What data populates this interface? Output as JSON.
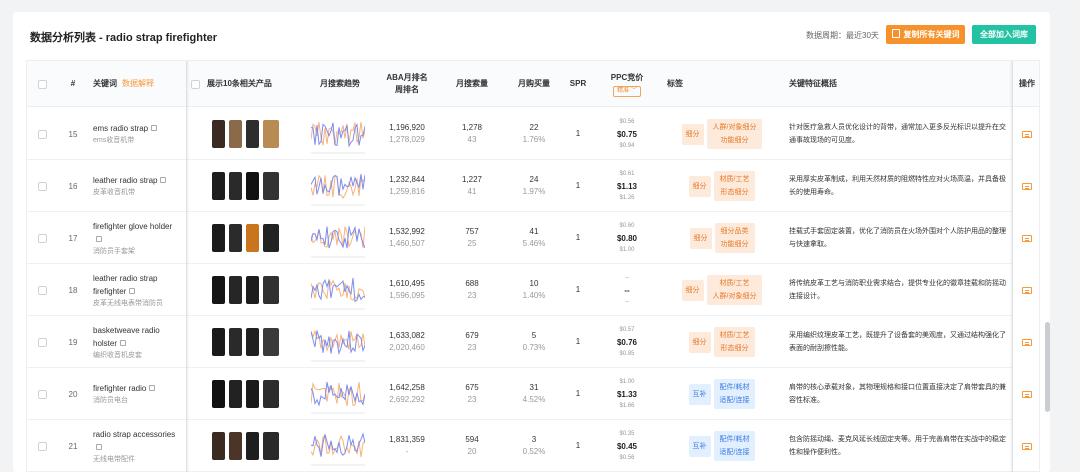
{
  "title": "数据分析列表 - radio strap firefighter",
  "period": "数据周期：最近30天",
  "buttons": {
    "copy_all": "复制所有关键词",
    "add_all": "全部加入词库"
  },
  "headers": {
    "index": "#",
    "keyword": "关键词",
    "keyword_explain": "数据解释",
    "products": "展示10条相关产品",
    "trend": "月搜索趋势",
    "aba": "ABA月排名\n周排名",
    "search_volume": "月搜索量",
    "purchases": "月购买量",
    "spr": "SPR",
    "ppc": "PPC竞价",
    "ppc_mode": "精准",
    "tags": "标签",
    "features": "关键特征概括",
    "ops": "操作"
  },
  "rows": [
    {
      "index": "15",
      "keyword": "ems radio strap",
      "keyword_cn": "ems收音机带",
      "aba": "1,196,920",
      "aba_week": "1,278,029",
      "volume": "1,278",
      "volume_sub": "43",
      "purchases": "22",
      "purchase_rate": "1.76%",
      "spr": "1",
      "ppc_high": "$0.56",
      "ppc_mid": "$0.75",
      "ppc_low": "$0.94",
      "tag_type": "细分",
      "tag_color": "fen",
      "tag_a": "人群/对象细分",
      "tag_b": "功能细分",
      "feature": "针对医疗急救人员优化设计的背带，通常加入更多反光标识以提升在交通事故现场的可见度。",
      "product_colors": [
        "#3a2a22",
        "#8b6a4a",
        "#2d2d2d",
        "#b98b54"
      ]
    },
    {
      "index": "16",
      "keyword": "leather radio strap",
      "keyword_cn": "皮革收音机带",
      "aba": "1,232,844",
      "aba_week": "1,259,816",
      "volume": "1,227",
      "volume_sub": "41",
      "purchases": "24",
      "purchase_rate": "1.97%",
      "spr": "1",
      "ppc_high": "$0.61",
      "ppc_mid": "$1.13",
      "ppc_low": "$1.26",
      "tag_type": "细分",
      "tag_color": "fen",
      "tag_a": "材质/工艺",
      "tag_b": "形态细分",
      "feature": "采用厚实皮革制成，利用天然材质的阻燃特性应对火场高温，并具备极长的使用寿命。",
      "product_colors": [
        "#1e1e1e",
        "#2a2a2a",
        "#111111",
        "#333333"
      ]
    },
    {
      "index": "17",
      "keyword": "firefighter glove holder",
      "keyword_cn": "消防员手套架",
      "aba": "1,532,992",
      "aba_week": "1,460,507",
      "volume": "757",
      "volume_sub": "25",
      "purchases": "41",
      "purchase_rate": "5.46%",
      "spr": "1",
      "ppc_high": "$0.60",
      "ppc_mid": "$0.80",
      "ppc_low": "$1.00",
      "tag_type": "细分",
      "tag_color": "fen",
      "tag_a": "细分品类",
      "tag_b": "功能细分",
      "feature": "挂载式手套固定装置，优化了消防员在火场外围对个人防护用品的整理与快速拿取。",
      "product_colors": [
        "#1b1b1b",
        "#2b2b2b",
        "#c9751e",
        "#222222"
      ]
    },
    {
      "index": "18",
      "keyword": "leather radio strap firefighter",
      "keyword_cn": "皮革无线电表带消防员",
      "aba": "1,610,495",
      "aba_week": "1,596,095",
      "volume": "688",
      "volume_sub": "23",
      "purchases": "10",
      "purchase_rate": "1.40%",
      "spr": "1",
      "ppc_high": "--",
      "ppc_mid": "--",
      "ppc_low": "--",
      "tag_type": "细分",
      "tag_color": "fen",
      "tag_a": "材质/工艺",
      "tag_b": "人群/对象细分",
      "feature": "将传统皮革工艺与消防职业需求结合，提供专业化的徽章挂载和防摇动连接设计。",
      "product_colors": [
        "#151515",
        "#262626",
        "#1d1d1d",
        "#303030"
      ]
    },
    {
      "index": "19",
      "keyword": "basketweave radio holster",
      "keyword_cn": "编织收音机皮套",
      "aba": "1,633,082",
      "aba_week": "2,020,460",
      "volume": "679",
      "volume_sub": "23",
      "purchases": "5",
      "purchase_rate": "0.73%",
      "spr": "1",
      "ppc_high": "$0.57",
      "ppc_mid": "$0.76",
      "ppc_low": "$0.85",
      "tag_type": "细分",
      "tag_color": "fen",
      "tag_a": "材质/工艺",
      "tag_b": "形态细分",
      "feature": "采用编织纹理皮革工艺，既提升了设备套的美观度，又通过结构强化了表面的耐刮擦性能。",
      "product_colors": [
        "#1a1a1a",
        "#2a2a2a",
        "#202020",
        "#3a3a3a"
      ]
    },
    {
      "index": "20",
      "keyword": "firefighter radio",
      "keyword_cn": "消防员电台",
      "aba": "1,642,258",
      "aba_week": "2,692,292",
      "volume": "675",
      "volume_sub": "23",
      "purchases": "31",
      "purchase_rate": "4.52%",
      "spr": "1",
      "ppc_high": "$1.00",
      "ppc_mid": "$1.33",
      "ppc_low": "$1.66",
      "tag_type": "互补",
      "tag_color": "bu",
      "tag_a": "配件/耗材",
      "tag_b": "适配/连接",
      "feature": "肩带的核心承载对象，其物理规格和接口位置直接决定了肩带套具的兼容性标准。",
      "product_colors": [
        "#111111",
        "#222222",
        "#1a1a1a",
        "#2c2c2c"
      ]
    },
    {
      "index": "21",
      "keyword": "radio strap accessories",
      "keyword_cn": "无线电带配件",
      "aba": "1,831,359",
      "aba_week": "-",
      "volume": "594",
      "volume_sub": "20",
      "purchases": "3",
      "purchase_rate": "0.52%",
      "spr": "1",
      "ppc_high": "$0.35",
      "ppc_mid": "$0.45",
      "ppc_low": "$0.56",
      "tag_type": "互补",
      "tag_color": "bu",
      "tag_a": "配件/耗材",
      "tag_b": "适配/连接",
      "feature": "包含防摇动绳、麦克风延长线固定夹等。用于完善肩带在实战中的稳定性和操作便利性。",
      "product_colors": [
        "#3b2a20",
        "#4a3526",
        "#1e1e1e",
        "#2a2a2a"
      ]
    }
  ],
  "colors": {
    "accent_orange": "#f5922b",
    "accent_green": "#23c2a2",
    "trend_blue": "#7b8cf0",
    "trend_orange": "#f7b27a"
  }
}
